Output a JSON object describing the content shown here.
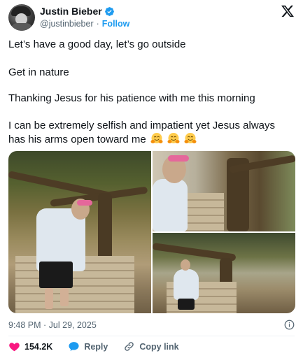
{
  "author": {
    "name": "Justin Bieber",
    "handle": "@justinbieber",
    "separator": "·",
    "follow_label": "Follow"
  },
  "tweet": {
    "lines": [
      "Let’s have a good day, let’s go outside",
      "Get in nature",
      "Thanking Jesus for his patience with me this morning",
      "I can be extremely selfish and impatient yet Jesus always",
      "has his arms open toward me"
    ],
    "emoji_icon": "hugging-face-icon",
    "emoji_count": 3
  },
  "media": {
    "count": 3
  },
  "meta": {
    "timestamp": "9:48 PM · Jul 29, 2025"
  },
  "actions": {
    "like_count": "154.2K",
    "reply_label": "Reply",
    "copy_label": "Copy link"
  },
  "colors": {
    "accent": "#1d9bf0",
    "like": "#f91880",
    "text": "#0f1419",
    "muted": "#536471"
  }
}
